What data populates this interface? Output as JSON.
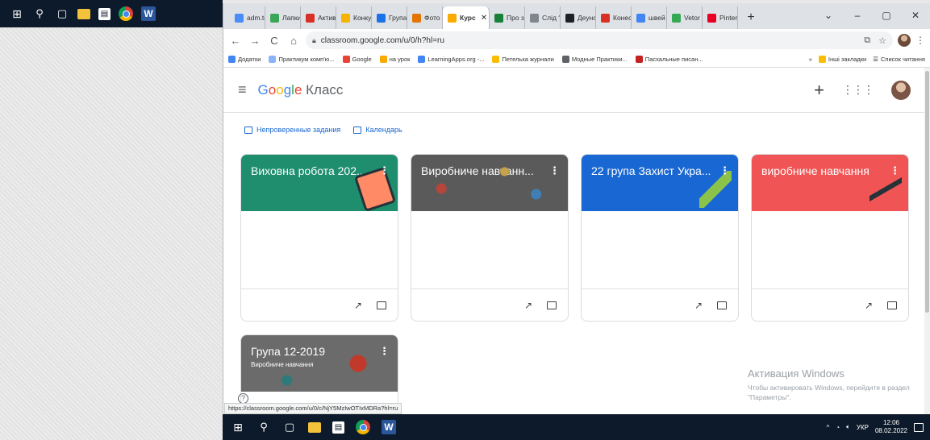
{
  "desktop": {
    "top_taskbar_icons": [
      "windows-icon",
      "search-icon",
      "task-view-icon",
      "file-explorer-icon",
      "store-icon",
      "chrome-icon",
      "word-icon"
    ]
  },
  "browser": {
    "tabs": [
      {
        "label": "adm.tc",
        "color": "#4a8df8"
      },
      {
        "label": "Лапки",
        "color": "#3aa757"
      },
      {
        "label": "Активу",
        "color": "#d93025"
      },
      {
        "label": "Конку",
        "color": "#f4b400"
      },
      {
        "label": "Група",
        "color": "#1a73e8"
      },
      {
        "label": "Фото",
        "color": "#e37400"
      },
      {
        "label": "Курс",
        "color": "#f9ab00",
        "active": true
      },
      {
        "label": "Про з",
        "color": "#188038"
      },
      {
        "label": "Слід ?",
        "color": "#80868b"
      },
      {
        "label": "Деунс",
        "color": "#202124"
      },
      {
        "label": "Конес",
        "color": "#d93025"
      },
      {
        "label": "швей",
        "color": "#4285f4"
      },
      {
        "label": "Vetor",
        "color": "#34a853"
      },
      {
        "label": "Pinter",
        "color": "#e60023"
      }
    ],
    "url": "classroom.google.com/u/0/h?hl=ru",
    "bookmarks": [
      {
        "label": "Додатки",
        "color": "#4285f4"
      },
      {
        "label": "Практикум комп'ю...",
        "color": "#8ab4f8"
      },
      {
        "label": "Google",
        "color": "#ea4335"
      },
      {
        "label": "на урок",
        "color": "#f9ab00"
      },
      {
        "label": "LearningApps.org -...",
        "color": "#4285f4"
      },
      {
        "label": "Петелька журнали",
        "color": "#fbbc04"
      },
      {
        "label": "Модные Практики...",
        "color": "#5f6368"
      },
      {
        "label": "Пасхальные писан...",
        "color": "#c5221f"
      }
    ],
    "bookmarks_more": "»",
    "other_bookmarks": "Інші закладки",
    "reading_list": "Список читання",
    "status_url": "https://classroom.google.com/u/0/c/NjY5MzIwOTIxMDRa?hl=ru"
  },
  "classroom": {
    "logo_google": "Google",
    "logo_product": "Класс",
    "quicklinks": {
      "unchecked": "Непроверенные задания",
      "calendar": "Календарь"
    },
    "cards": [
      {
        "title": "Виховна робота 202...",
        "subtitle": "",
        "color": "#1e8e6e"
      },
      {
        "title": "Виробниче навчанн...",
        "subtitle": "",
        "color": "#5a5a5a"
      },
      {
        "title": "22 група Захист Укра...",
        "subtitle": "",
        "color": "#1967d2"
      },
      {
        "title": "виробниче навчання",
        "subtitle": "",
        "color": "#f05454"
      },
      {
        "title": "Група 12-2019",
        "subtitle": "Виробниче навчання",
        "color": "#6b6b6b"
      }
    ],
    "help": "?"
  },
  "activation": {
    "title": "Активация Windows",
    "text": "Чтобы активировать Windows, перейдите в раздел \"Параметры\"."
  },
  "taskbar": {
    "lang": "УКР",
    "time": "12:06",
    "date": "08.02.2022"
  }
}
